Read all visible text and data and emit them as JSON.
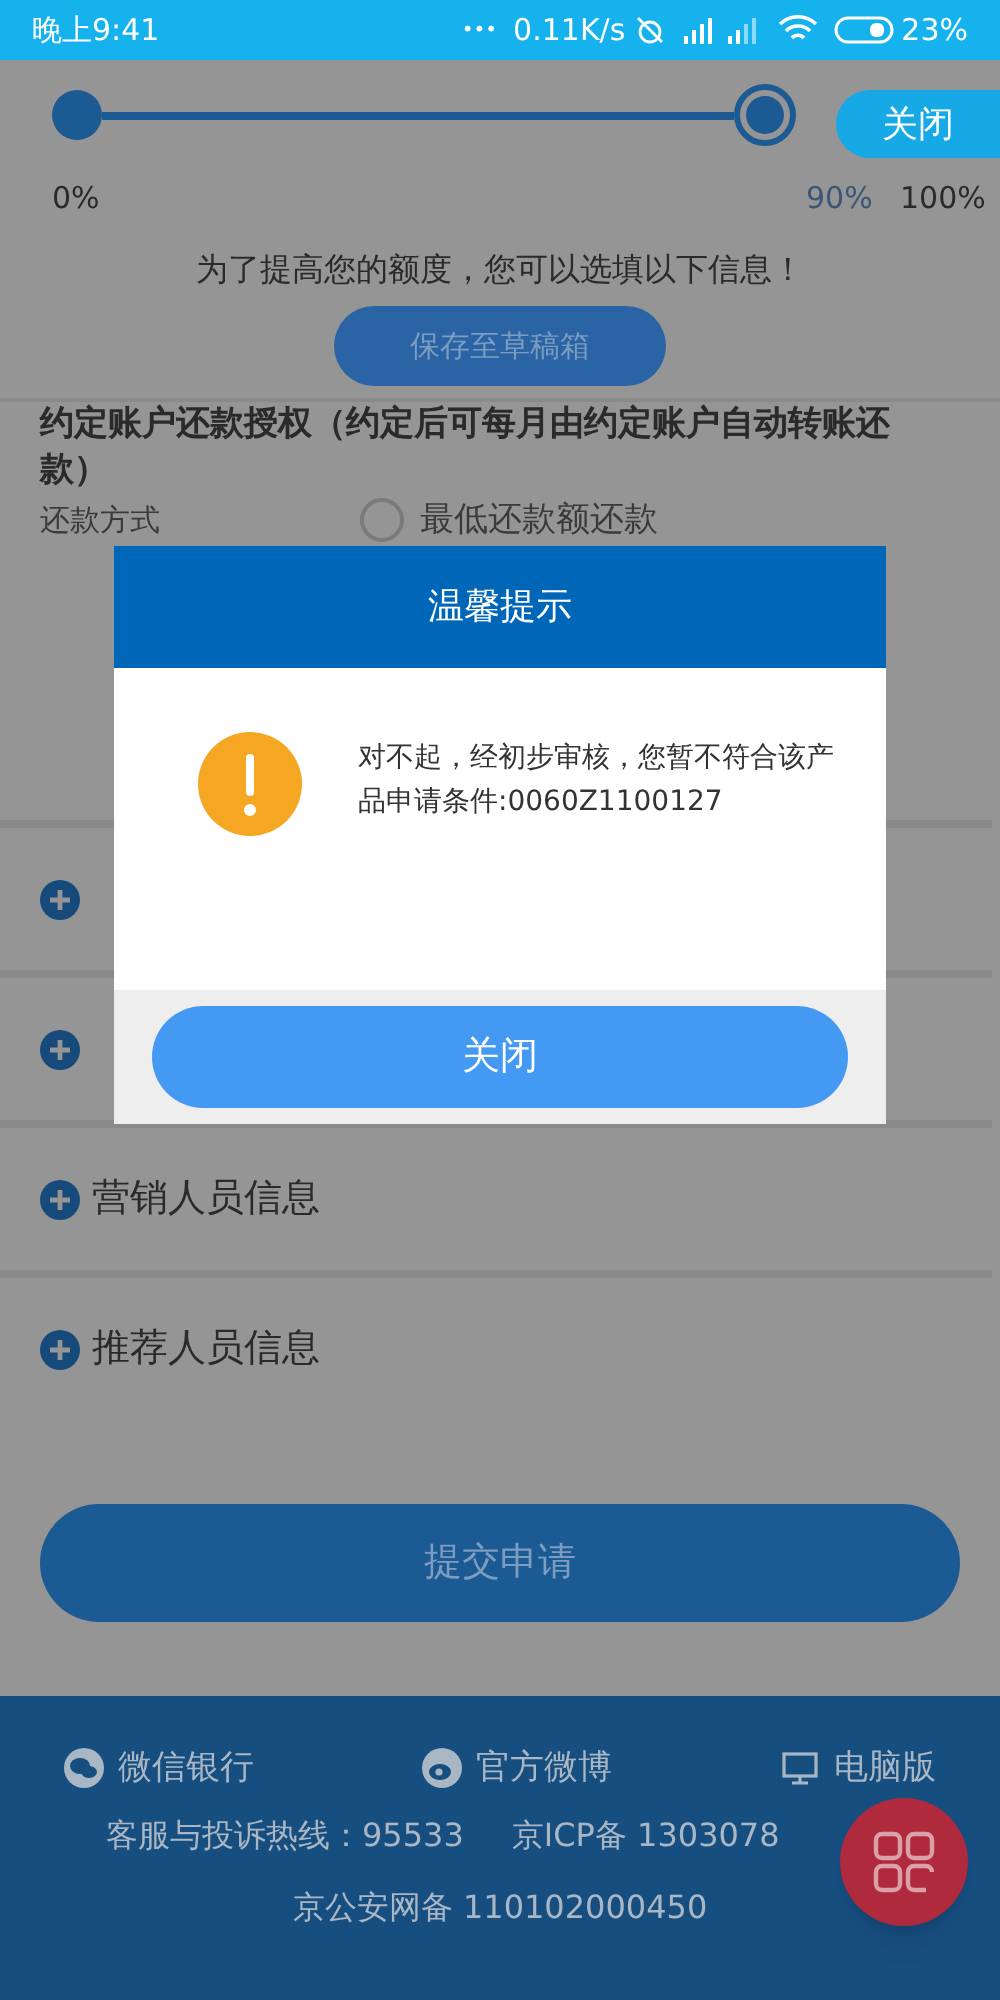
{
  "status_bar": {
    "time": "晚上9:41",
    "dots": "•••",
    "speed": "0.11K/s",
    "battery": "23%"
  },
  "progress": {
    "level": 0.9,
    "start_label": "0%",
    "current_label": "90%",
    "end_label": "100%"
  },
  "close_tag": "关闭",
  "hint": "为了提高您的额度，您可以选填以下信息！",
  "save_draft_button": "保存至草稿箱",
  "repayment_section": {
    "title": "约定账户还款授权（约定后可每月由约定账户自动转账还款）",
    "method_label": "还款方式",
    "options": [
      {
        "label": "最低还款额还款",
        "selected": false
      }
    ]
  },
  "sections": [
    {
      "expanded": false
    },
    {
      "expanded": false
    },
    {
      "expanded": false,
      "label": "营销人员信息"
    },
    {
      "expanded": false,
      "label": "推荐人员信息"
    }
  ],
  "submit_button": "提交申请",
  "footer": {
    "links": [
      {
        "kind": "wechat",
        "label": "微信银行"
      },
      {
        "kind": "weibo",
        "label": "官方微博"
      },
      {
        "kind": "desktop",
        "label": "电脑版"
      }
    ],
    "hotline": "客服与投诉热线：95533",
    "icp": "京ICP备 1303078",
    "police": "京公安网备 110102000450"
  },
  "dialog": {
    "title": "温馨提示",
    "message": "对不起，经初步审核，您暂不符合该产品申请条件:0060Z1100127",
    "close_button": "关闭"
  }
}
